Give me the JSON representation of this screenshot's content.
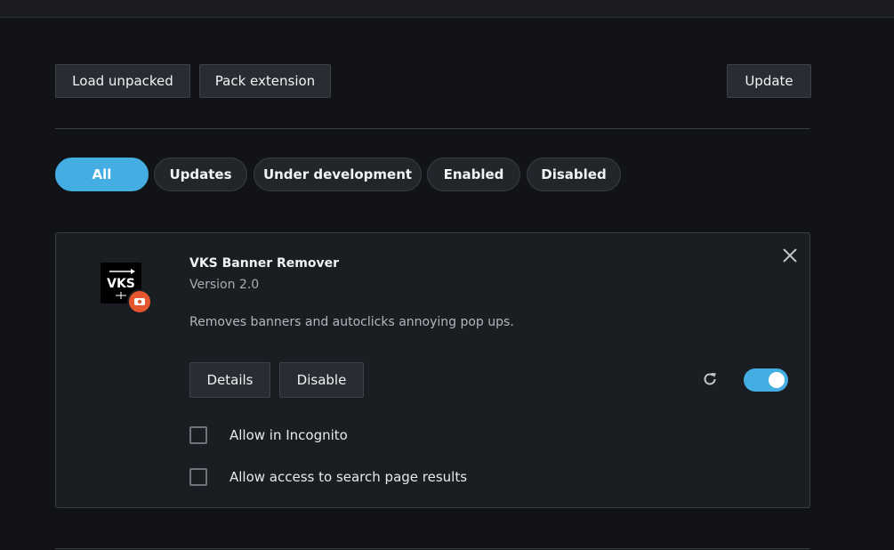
{
  "toolbar": {
    "load_unpacked": "Load unpacked",
    "pack_extension": "Pack extension",
    "update": "Update"
  },
  "filters": [
    {
      "label": "All",
      "active": true
    },
    {
      "label": "Updates",
      "active": false
    },
    {
      "label": "Under development",
      "active": false
    },
    {
      "label": "Enabled",
      "active": false
    },
    {
      "label": "Disabled",
      "active": false
    }
  ],
  "extension": {
    "name": "VKS Banner Remover",
    "version": "Version 2.0",
    "description": "Removes banners and autoclicks annoying pop ups.",
    "logo_text": "VKS",
    "details_label": "Details",
    "disable_label": "Disable",
    "enabled": true,
    "options": [
      {
        "label": "Allow in Incognito",
        "checked": false
      },
      {
        "label": "Allow access to search page results",
        "checked": false
      }
    ]
  },
  "colors": {
    "accent": "#44aee3",
    "badge": "#e4572e",
    "background": "#121316",
    "card": "#1a1d21"
  },
  "icons": {
    "close": "close-icon",
    "reload": "reload-icon",
    "badge": "opera-extension-badge-icon"
  }
}
